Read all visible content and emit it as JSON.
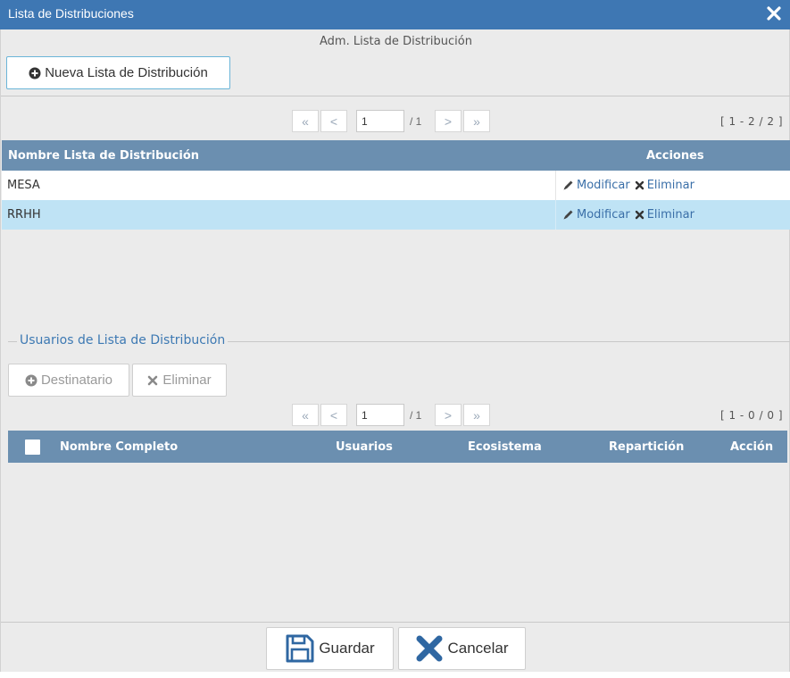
{
  "dialog": {
    "title": "Lista de Distribuciones",
    "subtitle": "Adm. Lista de Distribución",
    "new_button": "Nueva Lista de Distribución"
  },
  "lists_pager": {
    "first": "«",
    "prev": "<",
    "page": "1",
    "total": "/ 1",
    "next": ">",
    "last": "»",
    "count": "[ 1 - 2 / 2 ]"
  },
  "lists_table": {
    "columns": [
      "Nombre Lista de Distribución",
      "Acciones"
    ],
    "rows": [
      {
        "name": "MESA",
        "modify": "Modificar",
        "delete": "Eliminar",
        "selected": false
      },
      {
        "name": "RRHH",
        "modify": "Modificar",
        "delete": "Eliminar",
        "selected": true
      }
    ]
  },
  "users_section": {
    "legend": "Usuarios de Lista de Distribución",
    "add_button": "Destinatario",
    "delete_button": "Eliminar",
    "pager": {
      "first": "«",
      "prev": "<",
      "page": "1",
      "total": "/ 1",
      "next": ">",
      "last": "»",
      "count": "[ 1 - 0 / 0 ]"
    },
    "columns": [
      "Nombre Completo",
      "Usuarios",
      "Ecosistema",
      "Repartición",
      "Acción"
    ]
  },
  "footer": {
    "save": "Guardar",
    "cancel": "Cancelar"
  },
  "colors": {
    "titlebar": "#3e77b3",
    "table_header": "#6b8fb0",
    "selected_row": "#bfe3f5",
    "link": "#3a6fa8",
    "legend": "#3d79b3"
  },
  "icons": {
    "close": "close-icon",
    "add": "plus-circle-icon",
    "edit": "pencil-icon",
    "delete": "x-icon",
    "save": "floppy-disk-icon",
    "cancel": "x-icon"
  }
}
